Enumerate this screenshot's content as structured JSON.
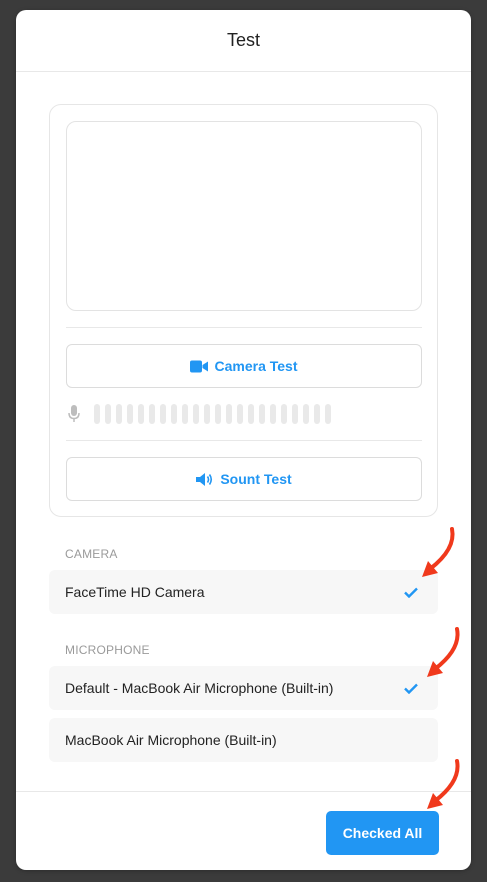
{
  "dialog": {
    "title": "Test"
  },
  "tests": {
    "camera_test_label": "Camera Test",
    "sound_test_label": "Sount Test",
    "mic_level_bars": 22
  },
  "camera": {
    "section_label": "CAMERA",
    "devices": [
      {
        "label": "FaceTime HD Camera",
        "selected": true
      }
    ]
  },
  "microphone": {
    "section_label": "MICROPHONE",
    "devices": [
      {
        "label": "Default - MacBook Air Microphone (Built-in)",
        "selected": true
      },
      {
        "label": "MacBook Air Microphone (Built-in)",
        "selected": false
      }
    ]
  },
  "footer": {
    "primary_label": "Checked All"
  },
  "colors": {
    "accent": "#2196f3",
    "annotation_arrow": "#f0391c"
  },
  "icons": {
    "camera_test": "video-camera-icon",
    "sound_test": "speaker-icon",
    "mic": "microphone-icon",
    "selected": "checkmark-icon"
  }
}
